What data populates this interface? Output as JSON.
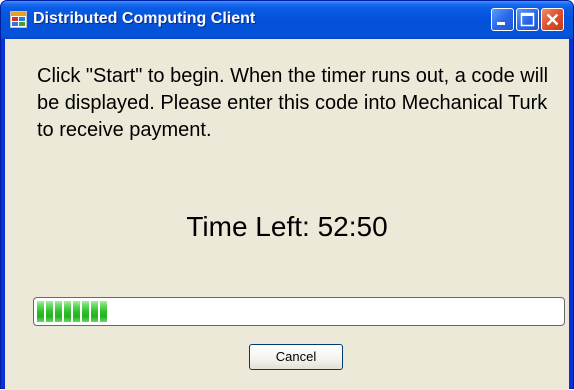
{
  "window": {
    "title": "Distributed Computing Client",
    "icons": {
      "app": "app-window-icon",
      "minimize": "minimize-icon",
      "maximize": "maximize-icon",
      "close": "close-icon"
    }
  },
  "content": {
    "instructions": "Click \"Start\" to begin.  When the timer runs out, a code will be displayed.  Please enter this code into Mechanical Turk to receive payment.",
    "timer_label": "Time Left: 52:50"
  },
  "progress": {
    "value_fraction": 0.14,
    "color": "#2fbf2a"
  },
  "buttons": {
    "cancel_label": "Cancel"
  },
  "colors": {
    "titlebar": "#0553dc",
    "client_background": "#ece9d8",
    "close_button": "#e0502a"
  }
}
